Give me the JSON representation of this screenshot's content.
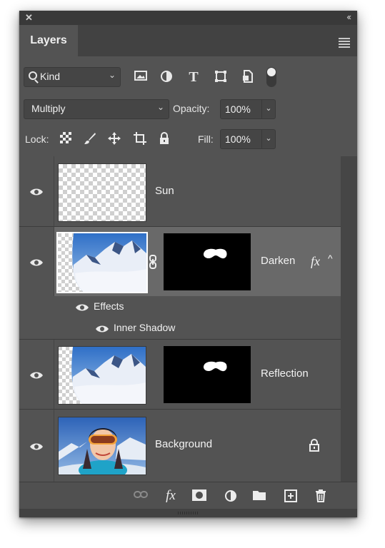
{
  "panel": {
    "close_label": "✕",
    "collapse_label": "‹‹",
    "tab_label": "Layers",
    "menu_icon": "panel-menu-icon"
  },
  "filter": {
    "kind_label": "Kind",
    "icons": [
      "image-filter-icon",
      "adjustment-filter-icon",
      "type-filter-icon",
      "shape-filter-icon",
      "smart-object-filter-icon",
      "filter-toggle"
    ]
  },
  "blend": {
    "mode": "Multiply",
    "opacity_label": "Opacity:",
    "opacity_value": "100%"
  },
  "lock": {
    "label": "Lock:",
    "fill_label": "Fill:",
    "fill_value": "100%",
    "icons": [
      "lock-transparent-pixels-icon",
      "lock-image-pixels-icon",
      "lock-position-icon",
      "lock-artboard-icon",
      "lock-all-icon"
    ]
  },
  "layers": [
    {
      "name": "Sun",
      "visible": true,
      "selected": false
    },
    {
      "name": "Darken",
      "visible": true,
      "selected": true,
      "fx": "fx",
      "effects_label": "Effects",
      "effects": [
        "Inner Shadow"
      ]
    },
    {
      "name": "Reflection",
      "visible": true,
      "selected": false
    },
    {
      "name": "Background",
      "visible": true,
      "selected": false,
      "locked": true
    }
  ],
  "bottom_icons": [
    "link-layers-icon",
    "fx-icon",
    "add-mask-icon",
    "new-adjustment-icon",
    "new-group-icon",
    "new-layer-icon",
    "delete-layer-icon"
  ],
  "bottom_fx_label": "fx",
  "colors": {
    "panel_bg": "#535353",
    "selected_bg": "#6a6a6a",
    "text": "#f2f2f2"
  }
}
